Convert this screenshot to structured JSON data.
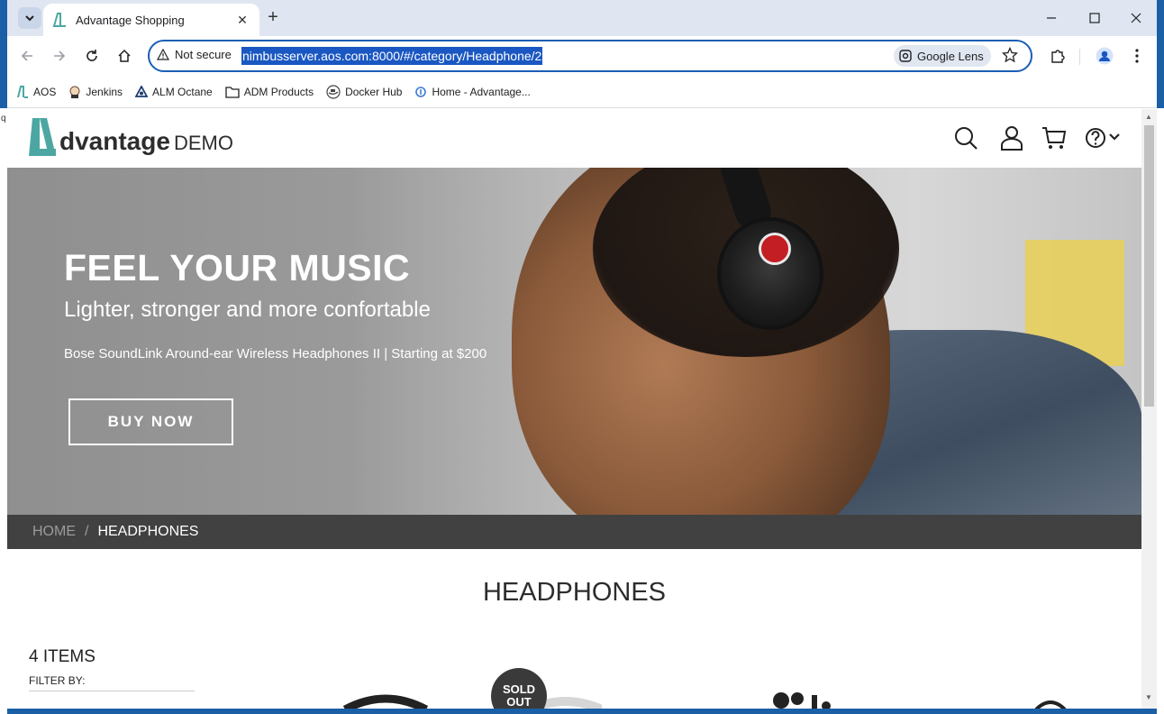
{
  "browser": {
    "tab_title": "Advantage Shopping",
    "security_label": "Not secure",
    "url": "nimbusserver.aos.com:8000/#/category/Headphone/2",
    "lens_label": "Google Lens"
  },
  "bookmarks": [
    {
      "label": "AOS",
      "icon": "aos-logo-icon"
    },
    {
      "label": "Jenkins",
      "icon": "jenkins-icon"
    },
    {
      "label": "ALM Octane",
      "icon": "octane-icon"
    },
    {
      "label": "ADM Products",
      "icon": "folder-icon"
    },
    {
      "label": "Docker Hub",
      "icon": "docker-icon"
    },
    {
      "label": "Home - Advantage...",
      "icon": "advantage-icon"
    }
  ],
  "site": {
    "logo_main": "dvantage",
    "logo_demo": "DEMO",
    "brand_color": "#4ca7a2"
  },
  "hero": {
    "title": "FEEL YOUR MUSIC",
    "subtitle": "Lighter, stronger and more confortable",
    "caption": "Bose SoundLink Around-ear Wireless Headphones II | Starting at $200",
    "button": "BUY NOW"
  },
  "breadcrumb": {
    "home": "HOME",
    "separator": "/",
    "current": "HEADPHONES"
  },
  "category": {
    "title": "HEADPHONES",
    "items_count": "4 ITEMS",
    "filter_label": "FILTER BY:",
    "sold_out_line1": "SOLD",
    "sold_out_line2": "OUT"
  }
}
